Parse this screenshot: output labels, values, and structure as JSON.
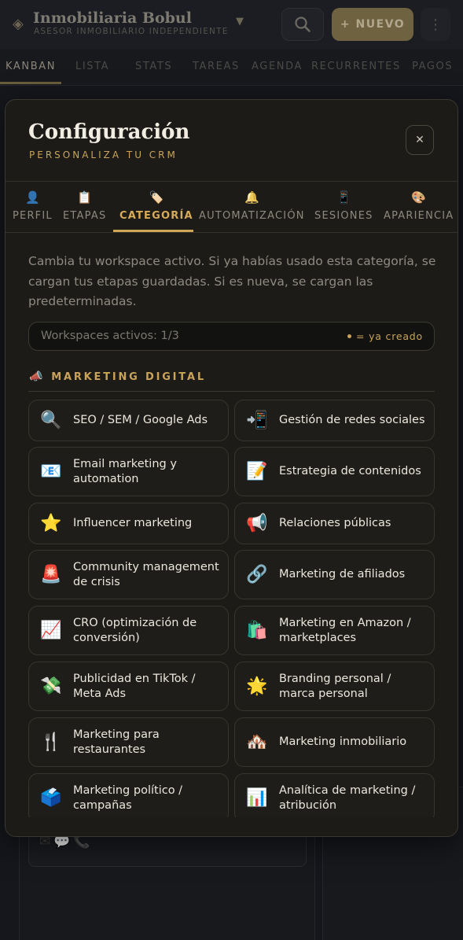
{
  "app": {
    "brand_name": "Inmobiliaria Bobul",
    "brand_subtitle": "ASESOR INMOBILIARIO INDEPENDIENTE",
    "new_button": "+ NUEVO"
  },
  "nav": {
    "tabs": [
      "KANBAN",
      "LISTA",
      "STATS",
      "TAREAS",
      "AGENDA",
      "RECURRENTES",
      "PAGOS"
    ],
    "active": "KANBAN"
  },
  "modal": {
    "title": "Configuración",
    "subtitle": "PERSONALIZA TU CRM",
    "close_label": "✕",
    "tabs": [
      {
        "icon": "👤",
        "icon_name": "user-icon",
        "label": "PERFIL"
      },
      {
        "icon": "📋",
        "icon_name": "clipboard-icon",
        "label": "ETAPAS"
      },
      {
        "icon": "🏷️",
        "icon_name": "tag-icon",
        "label": "CATEGORÍA"
      },
      {
        "icon": "🔔",
        "icon_name": "bell-icon",
        "label": "AUTOMATIZACIÓN"
      },
      {
        "icon": "📱",
        "icon_name": "phone-icon",
        "label": "SESIONES"
      },
      {
        "icon": "🎨",
        "icon_name": "palette-icon",
        "label": "APARIENCIA"
      }
    ],
    "active_tab": "CATEGORÍA",
    "description": "Cambia tu workspace activo. Si ya habías usado esta categoría, se cargan tus etapas guardadas. Si es nueva, se cargan las predeterminadas.",
    "workspaces_text": "Workspaces activos: 1/3",
    "legend_text": "= ya creado",
    "section": {
      "icon": "📣",
      "icon_name": "megaphone-icon",
      "title": "MARKETING DIGITAL",
      "items": [
        {
          "icon": "🔍",
          "icon_name": "magnifier-icon",
          "label": "SEO / SEM / Google Ads"
        },
        {
          "icon": "📲",
          "icon_name": "mobile-arrow-icon",
          "label": "Gestión de redes sociales"
        },
        {
          "icon": "📧",
          "icon_name": "email-icon",
          "label": "Email marketing y automation"
        },
        {
          "icon": "📝",
          "icon_name": "memo-icon",
          "label": "Estrategia de contenidos"
        },
        {
          "icon": "⭐",
          "icon_name": "star-icon",
          "label": "Influencer marketing"
        },
        {
          "icon": "📢",
          "icon_name": "loudspeaker-icon",
          "label": "Relaciones públicas"
        },
        {
          "icon": "🚨",
          "icon_name": "siren-icon",
          "label": "Community management de crisis"
        },
        {
          "icon": "🔗",
          "icon_name": "link-icon",
          "label": "Marketing de afiliados"
        },
        {
          "icon": "📈",
          "icon_name": "chart-up-icon",
          "label": "CRO (optimización de conversión)"
        },
        {
          "icon": "🛍️",
          "icon_name": "shopping-bags-icon",
          "label": "Marketing en Amazon / marketplaces"
        },
        {
          "icon": "💸",
          "icon_name": "money-wings-icon",
          "label": "Publicidad en TikTok / Meta Ads"
        },
        {
          "icon": "🌟",
          "icon_name": "glowing-star-icon",
          "label": "Branding personal / marca personal"
        },
        {
          "icon": "🍴",
          "icon_name": "fork-knife-icon",
          "label": "Marketing para restaurantes"
        },
        {
          "icon": "🏘️",
          "icon_name": "houses-icon",
          "label": "Marketing inmobiliario"
        },
        {
          "icon": "🗳️",
          "icon_name": "ballot-box-icon",
          "label": "Marketing político / campañas"
        },
        {
          "icon": "📊",
          "icon_name": "bar-chart-icon",
          "label": "Analítica de marketing / atribución"
        }
      ]
    }
  },
  "colors": {
    "accent": "#c9a35a",
    "modal_bg": "#1c1b18",
    "page_bg": "#15171c"
  }
}
